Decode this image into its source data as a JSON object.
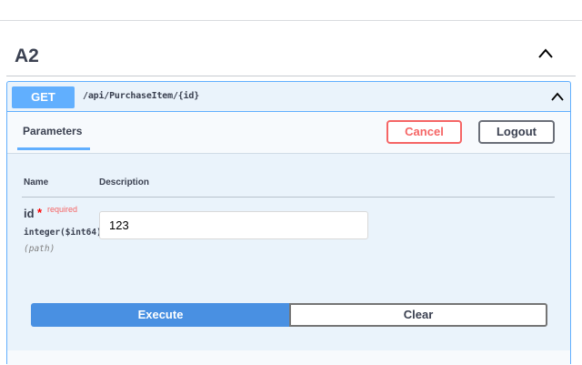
{
  "section": {
    "title": "A2",
    "chevron_icon": "chevron-up-icon"
  },
  "operation": {
    "method": "GET",
    "path": "/api/PurchaseItem/{id}",
    "chevron_icon": "chevron-up-icon",
    "method_color": "#61affe"
  },
  "parameters_bar": {
    "tab_label": "Parameters",
    "cancel_label": "Cancel",
    "logout_label": "Logout"
  },
  "table": {
    "headers": {
      "name": "Name",
      "description": "Description"
    }
  },
  "param": {
    "name": "id",
    "star": "*",
    "required_label": "required",
    "type": "integer($int64)",
    "location": "(path)",
    "value": "123"
  },
  "actions": {
    "execute_label": "Execute",
    "clear_label": "Clear"
  },
  "colors": {
    "accent": "#4990e2",
    "danger": "#f56565",
    "block_bg": "#eaf3fb"
  }
}
